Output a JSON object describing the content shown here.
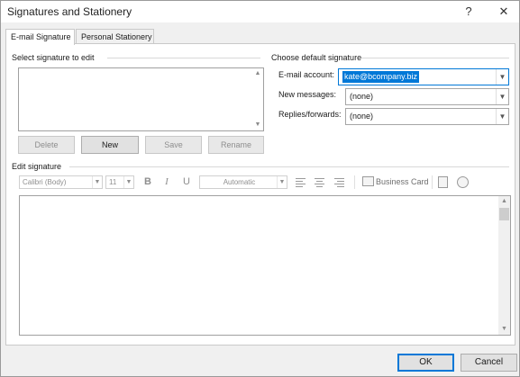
{
  "window": {
    "title": "Signatures and Stationery",
    "help_glyph": "?",
    "close_glyph": "✕"
  },
  "tabs": [
    {
      "label": "E-mail Signature",
      "active": true
    },
    {
      "label": "Personal Stationery",
      "active": false
    }
  ],
  "select_signature": {
    "label": "Select signature to edit",
    "buttons": {
      "delete": "Delete",
      "new": "New",
      "save": "Save",
      "rename": "Rename"
    }
  },
  "default_signature": {
    "label": "Choose default signature",
    "email_account": {
      "label": "E-mail account:",
      "value": "kate@bcompany.biz"
    },
    "new_messages": {
      "label": "New messages:",
      "value": "(none)"
    },
    "replies_forwards": {
      "label": "Replies/forwards:",
      "value": "(none)"
    }
  },
  "edit_signature": {
    "label": "Edit signature",
    "font": "Calibri (Body)",
    "size": "11",
    "bold": "B",
    "italic": "I",
    "underline": "U",
    "color": "Automatic",
    "business_card": "Business Card"
  },
  "footer": {
    "ok": "OK",
    "cancel": "Cancel"
  },
  "colors": {
    "accent": "#0078d7"
  }
}
